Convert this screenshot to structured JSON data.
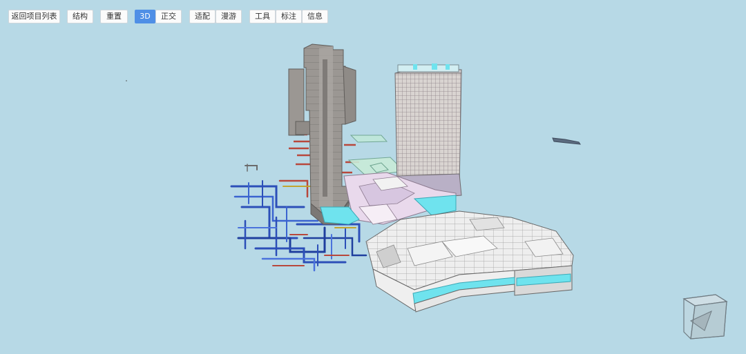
{
  "toolbar": {
    "back": "返回项目列表",
    "structure": "结构",
    "reset": "重置",
    "view_3d": "3D",
    "ortho": "正交",
    "fit": "适配",
    "roam": "漫游",
    "tools": "工具",
    "annotate": "标注",
    "info": "信息",
    "active": "3D"
  },
  "colors": {
    "background": "#b7d9e6",
    "active_button": "#4f8fe6",
    "tower_gray": "#8f8b87",
    "glass_cyan": "#6fe3ee",
    "pipe_blue": "#2c4fb8",
    "pipe_red": "#b8473b"
  },
  "viewport": {
    "model": "bim-building-model",
    "navigation": "view-cube"
  }
}
